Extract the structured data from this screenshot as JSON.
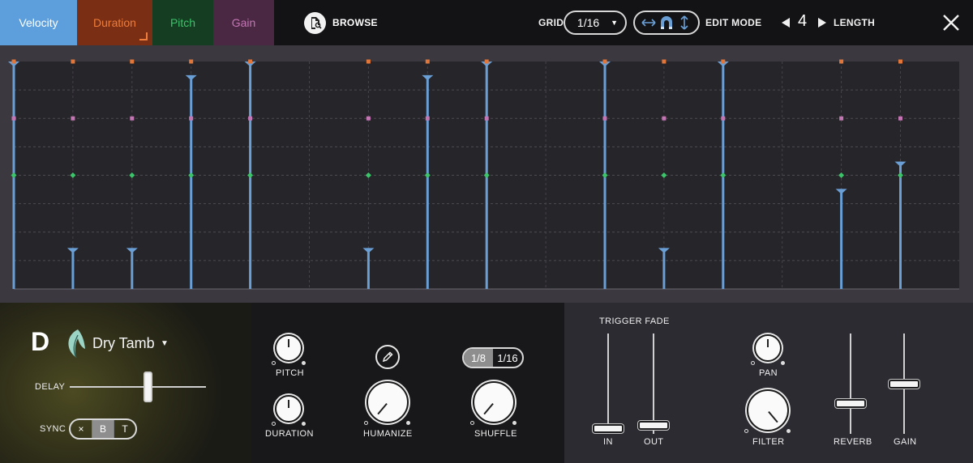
{
  "tabs": [
    {
      "label": "Velocity",
      "active": true
    },
    {
      "label": "Duration"
    },
    {
      "label": "Pitch"
    },
    {
      "label": "Gain"
    }
  ],
  "toolbar": {
    "browse_label": "BROWSE",
    "grid_label": "GRID",
    "grid_value": "1/16",
    "edit_mode_label": "EDIT MODE",
    "length_value": "4",
    "length_label": "LENGTH"
  },
  "colors": {
    "velocity": "#6a9fd6",
    "duration": "#e0763a",
    "pitch": "#3cc46a",
    "gain": "#c476b4"
  },
  "editor": {
    "steps": 16,
    "note_steps": [
      0,
      1,
      2,
      3,
      4,
      6,
      7,
      8,
      10,
      11,
      12,
      14,
      15
    ],
    "velocity": [
      1.0,
      0.18,
      0.18,
      0.94,
      1.0,
      0.18,
      0.94,
      1.0,
      1.0,
      0.18,
      1.0,
      0.44,
      0.56
    ],
    "duration_marker_level": 1.0,
    "gain_marker_level": 0.75,
    "pitch_marker_level": 0.5
  },
  "sample": {
    "slot": "D",
    "icon": "leaf-icon",
    "name": "Dry Tamb"
  },
  "controls": {
    "delay_label": "DELAY",
    "delay_value": 0.58,
    "sync_label": "SYNC",
    "sync_options": [
      "×",
      "B",
      "T"
    ],
    "sync_selected": "B",
    "pitch_label": "PITCH",
    "duration_label": "DURATION",
    "humanize_label": "HUMANIZE",
    "shuffle_label": "SHUFFLE",
    "shuffle_options": [
      "1/8",
      "1/16"
    ],
    "shuffle_selected": "1/8",
    "trigger_fade_label": "TRIGGER FADE",
    "in_label": "IN",
    "out_label": "OUT",
    "pan_label": "PAN",
    "filter_label": "FILTER",
    "reverb_label": "REVERB",
    "gain_label": "GAIN",
    "fade_in_value": 0.05,
    "fade_out_value": 0.08,
    "reverb_value": 0.3,
    "gain_value": 0.49
  }
}
